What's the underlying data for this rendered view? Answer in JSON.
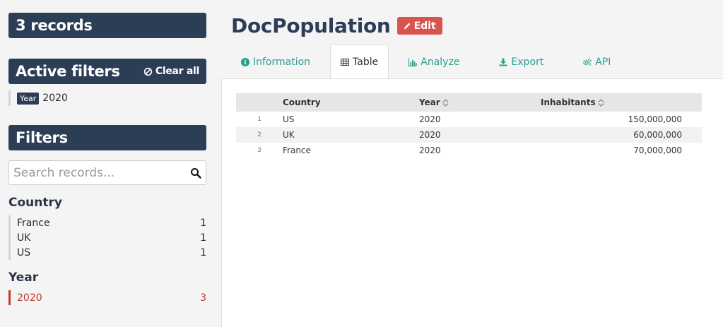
{
  "sidebar": {
    "records_label": "3 records",
    "active_filters_title": "Active filters",
    "clear_all_label": "Clear all",
    "active_filters": [
      {
        "tag": "Year",
        "value": "2020"
      }
    ],
    "filters_title": "Filters",
    "search_placeholder": "Search records...",
    "facets": [
      {
        "title": "Country",
        "items": [
          {
            "label": "France",
            "count": "1"
          },
          {
            "label": "UK",
            "count": "1"
          },
          {
            "label": "US",
            "count": "1"
          }
        ]
      },
      {
        "title": "Year",
        "items": [
          {
            "label": "2020",
            "count": "3"
          }
        ]
      }
    ]
  },
  "main": {
    "title": "DocPopulation",
    "edit_label": "Edit",
    "tabs": [
      {
        "label": "Information",
        "icon": "info-circle-icon"
      },
      {
        "label": "Table",
        "icon": "table-icon",
        "active": true
      },
      {
        "label": "Analyze",
        "icon": "bar-chart-icon"
      },
      {
        "label": "Export",
        "icon": "download-icon"
      },
      {
        "label": "API",
        "icon": "gears-icon"
      }
    ],
    "table": {
      "columns": [
        "Country",
        "Year",
        "Inhabitants"
      ],
      "rows": [
        {
          "index": "1",
          "country": "US",
          "year": "2020",
          "inhabitants": "150,000,000"
        },
        {
          "index": "2",
          "country": "UK",
          "year": "2020",
          "inhabitants": "60,000,000"
        },
        {
          "index": "3",
          "country": "France",
          "year": "2020",
          "inhabitants": "70,000,000"
        }
      ]
    }
  },
  "colors": {
    "navy": "#2c3e56",
    "teal_link": "#2a9d8f",
    "edit_red": "#d9534f",
    "active_facet_red": "#c0392b"
  }
}
